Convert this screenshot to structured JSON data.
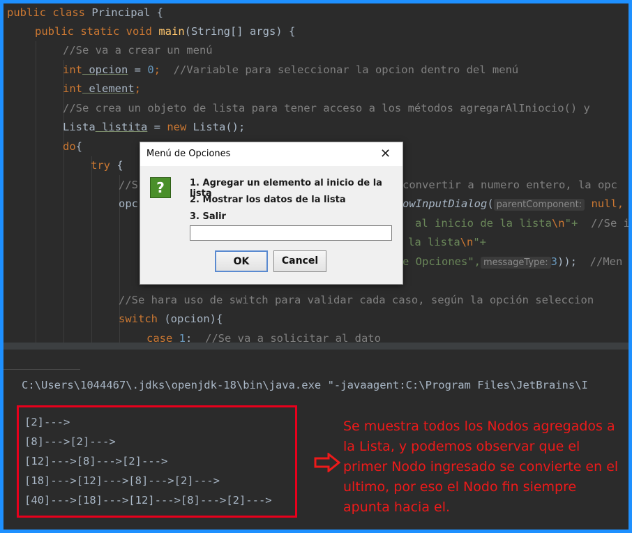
{
  "code": {
    "l1": {
      "kw": "public class",
      "name": " Principal {"
    },
    "l2": {
      "kw": "public static void",
      "fn": "main",
      "rest": "(String[] args) {"
    },
    "l3": {
      "cm": "//Se va a crear un menú"
    },
    "l4": {
      "kw": "int",
      "var": " opcion",
      "eq": " = ",
      "num": "0",
      "semi": ";  ",
      "cm": "//Variable para seleccionar la opcion dentro del menú"
    },
    "l5": {
      "kw": "int",
      "var": " element",
      "semi": ";"
    },
    "l6": {
      "cm": "//Se crea un objeto de lista para tener acceso a los métodos agregarAlIniocio() y"
    },
    "l7": {
      "type": "Lista",
      "var": " listita",
      "eq": " = ",
      "kw": "new",
      "rest": " Lista();"
    },
    "l8": {
      "kw": "do",
      "rest": "{"
    },
    "l9": {
      "kw": "try",
      "rest": " {"
    },
    "l10": {
      "cm1": "//S",
      "cm2": "convertir a numero entero, la opc"
    },
    "l11": {
      "a": "opc",
      "fn": "owInputDialog",
      "paren": "(",
      "hint": "parentComponent:",
      "rest": " null,"
    },
    "l12": {
      "str": "al inicio de la lista",
      "esc": "\\n",
      "str2": "\"+  ",
      "cm": "//Se i"
    },
    "l13": {
      "str": "la lista",
      "esc": "\\n",
      "str2": "\"+"
    },
    "l14": {
      "str": "e Opciones\",",
      "hint": "messageType:",
      "num": "3",
      "rest": "));  ",
      "cm": "//Men"
    },
    "l16": {
      "cm": "//Se hara uso de switch para validar cada caso, según la opción seleccion"
    },
    "l17": {
      "kw": "switch",
      "rest": " (opcion){"
    },
    "l18": {
      "kw": "case",
      "num": " 1",
      "rest": ":  ",
      "cm": "//Se va a solicitar al dato"
    }
  },
  "dialog": {
    "title": "Menú de Opciones",
    "close": "✕",
    "icon": "?",
    "options": [
      "1. Agregar un elemento al inicio de la lista",
      "2. Mostrar los datos de la lista",
      "3. Salir"
    ],
    "input_value": "",
    "ok": "OK",
    "cancel": "Cancel"
  },
  "run": {
    "command": "C:\\Users\\1044467\\.jdks\\openjdk-18\\bin\\java.exe \"-javaagent:C:\\Program Files\\JetBrains\\I",
    "output": [
      "[2]--->",
      "[8]--->[2]--->",
      "[12]--->[8]--->[2]--->",
      "[18]--->[12]--->[8]--->[2]--->",
      "[40]--->[18]--->[12]--->[8]--->[2]--->"
    ]
  },
  "annotation": {
    "text": "Se muestra todos los Nodos agregados a la Lista,  y podemos observar que el primer Nodo ingresado se convierte en el ultimo, por eso el Nodo fin siempre apunta hacia el.",
    "color": "#ee1a1a",
    "frame_color": "#1e90ff"
  }
}
